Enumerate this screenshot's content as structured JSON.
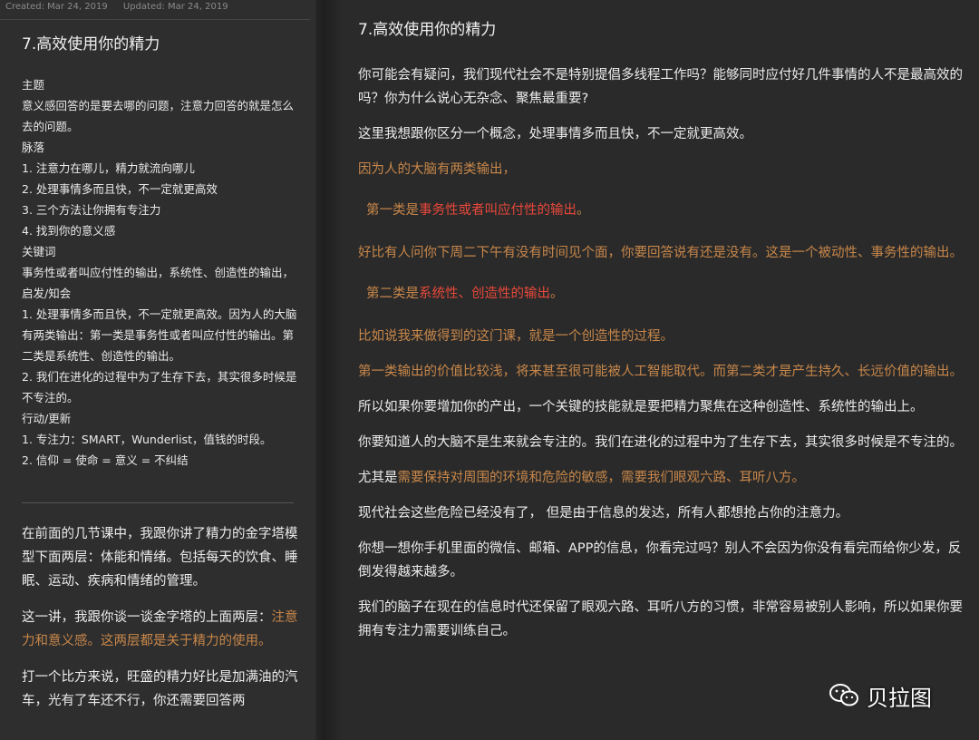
{
  "meta": {
    "created": "Created: Mar 24, 2019",
    "updated": "Updated: Mar 24, 2019"
  },
  "left": {
    "title": "7.高效使用你的精力",
    "outline": [
      "主题",
      "意义感回答的是要去哪的问题，注意力回答的就是怎么去的问题。",
      "脉落",
      "1. 注意力在哪儿，精力就流向哪儿",
      "2. 处理事情多而且快，不一定就更高效",
      "3. 三个方法让你拥有专注力",
      "4. 找到你的意义感",
      "关键词",
      "事务性或者叫应付性的输出，系统性、创造性的输出，",
      "启发/知会",
      "1. 处理事情多而且快，不一定就更高效。因为人的大脑有两类输出：第一类是事务性或者叫应付性的输出。第二类是系统性、创造性的输出。",
      "2. 我们在进化的过程中为了生存下去，其实很多时候是不专注的。",
      "行动/更新",
      "1. 专注力：SMART，Wunderlist，值钱的时段。",
      "2. 信仰 = 使命 = 意义 = 不纠结"
    ],
    "body": {
      "p1": "在前面的几节课中，我跟你讲了精力的金字塔模型下面两层：体能和情绪。包括每天的饮食、睡眠、运动、疾病和情绪的管理。",
      "p2_plain": "这一讲，我跟你谈一谈金字塔的上面两层：",
      "p2_orange": "注意力和意义感。这两层都是关于精力的使用。",
      "p3": "打一个比方来说，旺盛的精力好比是加满油的汽车，光有了车还不行，你还需要回答两"
    }
  },
  "right": {
    "title": "7.高效使用你的精力",
    "p1": "你可能会有疑问，我们现代社会不是特别提倡多线程工作吗？能够同时应付好几件事情的人不是最高效的吗？你为什么说心无杂念、聚焦最重要?",
    "p2": "这里我想跟你区分一个概念，处理事情多而且快，不一定就更高效。",
    "p3": "因为人的大脑有两类输出，",
    "p4_prefix": "第一类是",
    "p4_red": "事务性或者叫应付性的输出",
    "p4_suffix": "。",
    "p5": "好比有人问你下周二下午有没有时间见个面，你要回答说有还是没有。这是一个被动性、事务性的输出。",
    "p6_prefix": "第二类是",
    "p6_red": "系统性、创造性的输出",
    "p6_suffix": "。",
    "p7": "比如说我来做得到的这门课，就是一个创造性的过程。",
    "p8": "第一类输出的价值比较浅，将来甚至很可能被人工智能取代。而第二类才是产生持久、长远价值的输出。",
    "p9": "所以如果你要增加你的产出，一个关键的技能就是要把精力聚焦在这种创造性、系统性的输出上。",
    "p10": "你要知道人的大脑不是生来就会专注的。我们在进化的过程中为了生存下去，其实很多时候是不专注的。",
    "p11_plain": "尤其是",
    "p11_orange": "需要保持对周围的环境和危险的敏感，需要我们眼观六路、耳听八方。",
    "p12": "现代社会这些危险已经没有了， 但是由于信息的发达，所有人都想抢占你的注意力。",
    "p13": "你想一想你手机里面的微信、邮箱、APP的信息，你看完过吗？别人不会因为你没有看完而给你少发，反倒发得越来越多。",
    "p14": "我们的脑子在现在的信息时代还保留了眼观六路、耳听八方的习惯，非常容易被别人影响，所以如果你要拥有专注力需要训练自己。"
  },
  "watermark": {
    "text": "贝拉图"
  }
}
